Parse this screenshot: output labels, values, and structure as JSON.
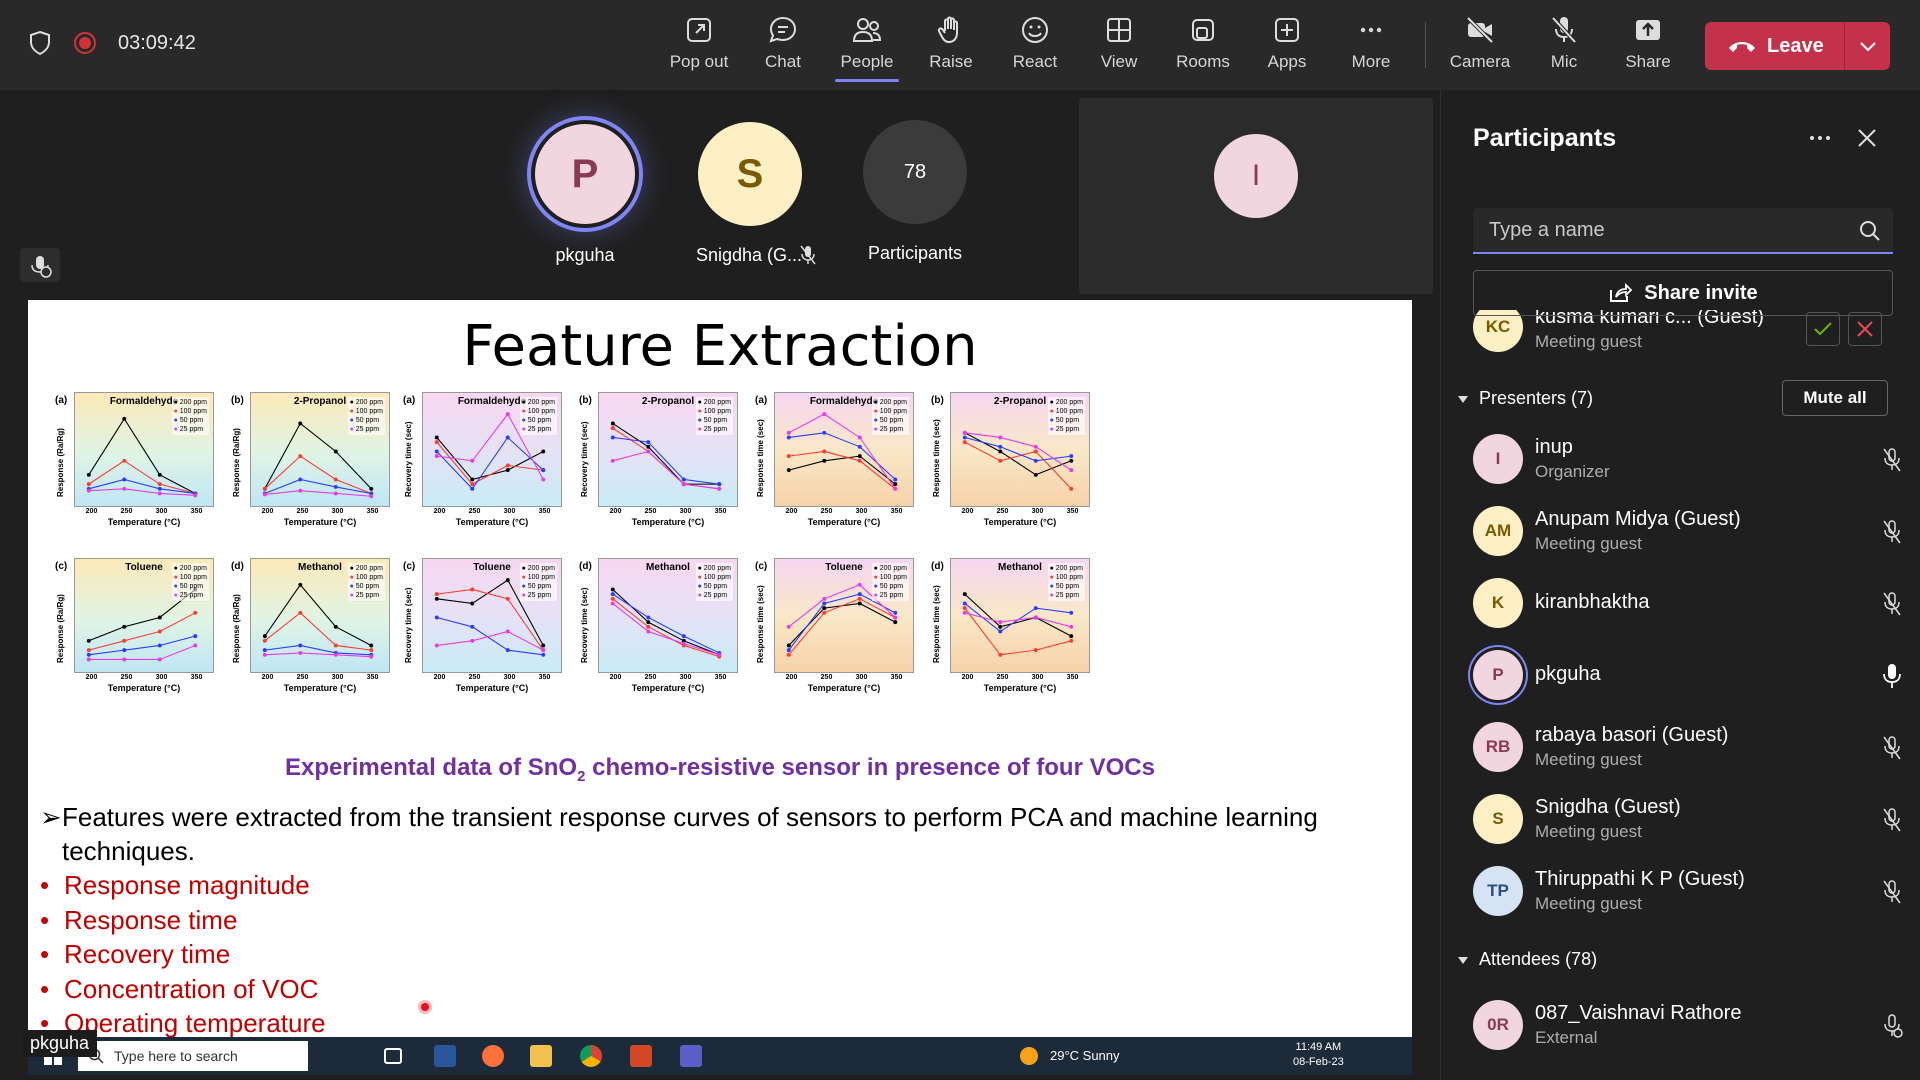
{
  "meeting": {
    "timer": "03:09:42"
  },
  "toolbar": {
    "buttons": [
      {
        "label": "Pop out"
      },
      {
        "label": "Chat"
      },
      {
        "label": "People"
      },
      {
        "label": "Raise"
      },
      {
        "label": "React"
      },
      {
        "label": "View"
      },
      {
        "label": "Rooms"
      },
      {
        "label": "Apps"
      },
      {
        "label": "More"
      },
      {
        "label": "Camera"
      },
      {
        "label": "Mic"
      },
      {
        "label": "Share"
      }
    ],
    "leave_label": "Leave"
  },
  "stage": {
    "tiles": [
      {
        "initial": "P",
        "name": "pkguha"
      },
      {
        "initial": "S",
        "name": "Snigdha (G..."
      },
      {
        "initial": "78",
        "name": "Participants"
      }
    ],
    "self_initial": "I",
    "presenter_label": "pkguha"
  },
  "slide": {
    "title": "Feature Extraction",
    "caption_pre": "Experimental data of SnO",
    "caption_sub": "2",
    "caption_post": " chemo-resistive sensor in presence of four VOCs",
    "main_bullet": "Features were extracted from the transient response curves of sensors to perform PCA and machine learning techniques.",
    "bullets": [
      "Response magnitude",
      "Response time",
      "Recovery time",
      "Concentration of VOC",
      "Operating temperature"
    ],
    "legend": [
      "200 ppm",
      "100 ppm",
      "50 ppm",
      "25 ppm"
    ],
    "xlabel": "Temperature (°C)",
    "xticks": [
      "200",
      "250",
      "300",
      "350"
    ],
    "charts": [
      {
        "label": "(a)",
        "title": "Formaldehyde",
        "ylabel": "Response (Ra/Rg)",
        "bg": "resp"
      },
      {
        "label": "(b)",
        "title": "2-Propanol",
        "ylabel": "Response (Ra/Rg)",
        "bg": "resp"
      },
      {
        "label": "(a)",
        "title": "Formaldehyde",
        "ylabel": "Recovery time (sec)",
        "bg": "rec"
      },
      {
        "label": "(b)",
        "title": "2-Propanol",
        "ylabel": "Recovery time (sec)",
        "bg": "rec"
      },
      {
        "label": "(a)",
        "title": "Formaldehyde",
        "ylabel": "Response time (sec)",
        "bg": "rt"
      },
      {
        "label": "(b)",
        "title": "2-Propanol",
        "ylabel": "Response time (sec)",
        "bg": "rt"
      },
      {
        "label": "(c)",
        "title": "Toluene",
        "ylabel": "Response (Ra/Rg)",
        "bg": "resp"
      },
      {
        "label": "(d)",
        "title": "Methanol",
        "ylabel": "Response (Ra/Rg)",
        "bg": "resp"
      },
      {
        "label": "(c)",
        "title": "Toluene",
        "ylabel": "Recovery time (sec)",
        "bg": "rec"
      },
      {
        "label": "(d)",
        "title": "Methanol",
        "ylabel": "Recovery time (sec)",
        "bg": "rec"
      },
      {
        "label": "(c)",
        "title": "Toluene",
        "ylabel": "Response time (sec)",
        "bg": "rt"
      },
      {
        "label": "(d)",
        "title": "Methanol",
        "ylabel": "Response time (sec)",
        "bg": "rt"
      }
    ]
  },
  "taskbar": {
    "search_placeholder": "Type here to search",
    "weather": "29°C  Sunny",
    "time": "11:49 AM",
    "date": "08-Feb-23"
  },
  "panel": {
    "title": "Participants",
    "search_placeholder": "Type a name",
    "invite_label": "Share invite",
    "lobby": {
      "initials": "KC",
      "name": "kusma kumari c...  (Guest)",
      "sub": "Meeting guest"
    },
    "presenters_label": "Presenters (7)",
    "mute_all_label": "Mute all",
    "presenters": [
      {
        "initials": "I",
        "name": "inup",
        "sub": "Organizer",
        "color": "#f1d6df",
        "text": "#8a3a55"
      },
      {
        "initials": "AM",
        "name": "Anupam Midya (Guest)",
        "sub": "Meeting guest",
        "color": "#fdf0c5",
        "text": "#7a5a00"
      },
      {
        "initials": "K",
        "name": "kiranbhaktha",
        "sub": "",
        "color": "#fdf0c5",
        "text": "#7a5a00"
      },
      {
        "initials": "P",
        "name": "pkguha",
        "sub": "",
        "color": "#f1d6df",
        "text": "#8a3a55"
      },
      {
        "initials": "RB",
        "name": "rabaya basori (Guest)",
        "sub": "Meeting guest",
        "color": "#f1d6df",
        "text": "#8a3a55"
      },
      {
        "initials": "S",
        "name": "Snigdha (Guest)",
        "sub": "Meeting guest",
        "color": "#fdf0c5",
        "text": "#7a5a00"
      },
      {
        "initials": "TP",
        "name": "Thiruppathi K P (Guest)",
        "sub": "Meeting guest",
        "color": "#d5e3f5",
        "text": "#2b4d7a"
      }
    ],
    "attendees_label": "Attendees (78)",
    "attendees": [
      {
        "initials": "0R",
        "name": "087_Vaishnavi Rathore",
        "sub": "External",
        "color": "#f1d6df",
        "text": "#8a3a55"
      }
    ]
  }
}
